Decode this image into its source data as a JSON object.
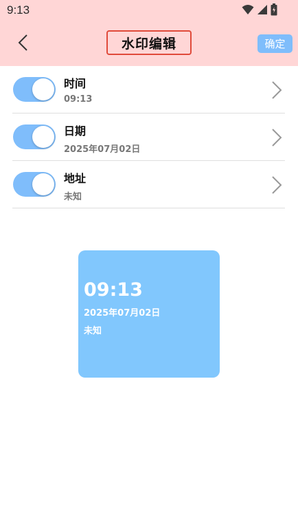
{
  "status_bar": {
    "time": "9:13",
    "icons": [
      "wifi-icon",
      "signal-icon",
      "battery-icon"
    ]
  },
  "header": {
    "title": "水印编辑",
    "confirm_label": "确定",
    "back_icon": "chevron-left-icon"
  },
  "settings": [
    {
      "label": "时间",
      "value": "09:13",
      "enabled": true
    },
    {
      "label": "日期",
      "value": "2025年07月02日",
      "enabled": true
    },
    {
      "label": "地址",
      "value": "未知",
      "enabled": true
    }
  ],
  "preview": {
    "time": "09:13",
    "date": "2025年07月02日",
    "address": "未知"
  },
  "colors": {
    "header_bg": "#ffd6d6",
    "accent": "#7fbdfb",
    "preview_bg": "#81c7fd",
    "title_border": "#e04a3a"
  }
}
